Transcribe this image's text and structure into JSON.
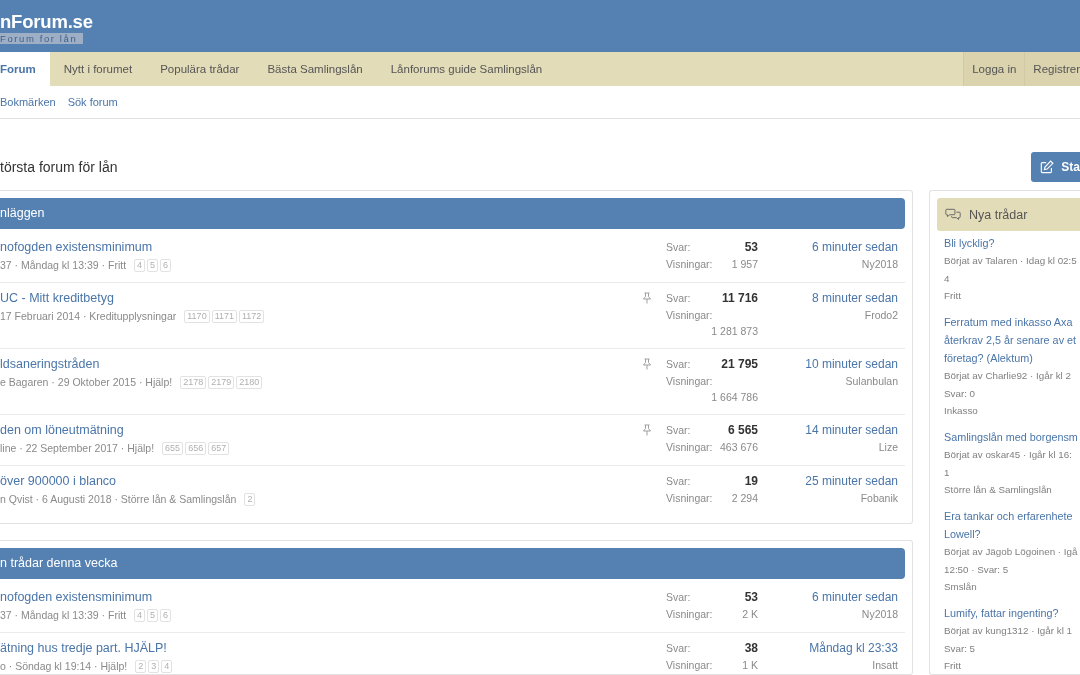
{
  "header": {
    "logo": "nForum.se",
    "tagline": "Forum for lån"
  },
  "nav": {
    "tabs": [
      {
        "label": "Forum",
        "selected": true
      },
      {
        "label": "Nytt i forumet",
        "selected": false
      },
      {
        "label": "Populära trådar",
        "selected": false
      },
      {
        "label": "Bästa Samlingslån",
        "selected": false
      },
      {
        "label": "Lånforums guide Samlingslån",
        "selected": false
      }
    ],
    "account_links": [
      "Logga in",
      "Registrer"
    ]
  },
  "sub_nav": [
    "Bokmärken",
    "Sök forum"
  ],
  "page": {
    "title": "törsta forum för lån",
    "new_thread_button": "Sta"
  },
  "blocks": [
    {
      "title": "nläggen",
      "threads": [
        {
          "title": "nofogden existensminimum",
          "meta": "37 · Måndag kl 13:39 · Fritt",
          "pages": [
            "4",
            "5",
            "6"
          ],
          "pinned": false,
          "replies_label": "Svar:",
          "replies": "53",
          "views_label": "Visningar:",
          "views": "1 957",
          "last_post": "6 minuter sedan",
          "last_poster": "Ny2018"
        },
        {
          "title": "UC - Mitt kreditbetyg",
          "meta": "17 Februari 2014 · Kreditupplysningar",
          "pages": [
            "1170",
            "1171",
            "1172"
          ],
          "pinned": true,
          "replies_label": "Svar:",
          "replies": "11 716",
          "views_label": "Visningar:",
          "views": "1 281 873",
          "last_post": "8 minuter sedan",
          "last_poster": "Frodo2"
        },
        {
          "title": "ldsaneringstråden",
          "meta": "e Bagaren · 29 Oktober 2015 · Hjälp!",
          "pages": [
            "2178",
            "2179",
            "2180"
          ],
          "pinned": true,
          "replies_label": "Svar:",
          "replies": "21 795",
          "views_label": "Visningar:",
          "views": "1 664 786",
          "last_post": "10 minuter sedan",
          "last_poster": "Sulanbulan"
        },
        {
          "title": "den om löneutmätning",
          "meta": "line · 22 September 2017 · Hjälp!",
          "pages": [
            "655",
            "656",
            "657"
          ],
          "pinned": true,
          "replies_label": "Svar:",
          "replies": "6 565",
          "views_label": "Visningar:",
          "views": "463 676",
          "last_post": "14 minuter sedan",
          "last_poster": "Lize"
        },
        {
          "title": "över 900000 i blanco",
          "meta": "n Qvist · 6 Augusti 2018 · Större lån & Samlingslån",
          "pages": [
            "2"
          ],
          "pinned": false,
          "replies_label": "Svar:",
          "replies": "19",
          "views_label": "Visningar:",
          "views": "2 294",
          "last_post": "25 minuter sedan",
          "last_poster": "Fobanik"
        }
      ]
    },
    {
      "title": "n trådar denna vecka",
      "threads": [
        {
          "title": "nofogden existensminimum",
          "meta": "37 · Måndag kl 13:39 · Fritt",
          "pages": [
            "4",
            "5",
            "6"
          ],
          "pinned": false,
          "replies_label": "Svar:",
          "replies": "53",
          "views_label": "Visningar:",
          "views": "2 K",
          "last_post": "6 minuter sedan",
          "last_poster": "Ny2018"
        },
        {
          "title": "ätning hus tredje part. HJÄLP!",
          "meta": "o · Söndag kl 19:14 · Hjälp!",
          "pages": [
            "2",
            "3",
            "4"
          ],
          "pinned": false,
          "replies_label": "Svar:",
          "replies": "38",
          "views_label": "Visningar:",
          "views": "1 K",
          "last_post": "Måndag kl 23:33",
          "last_poster": "Insatt"
        }
      ]
    }
  ],
  "sidebar": {
    "title": "Nya trådar",
    "threads": [
      {
        "title_lines": [
          "Bli lycklig?"
        ],
        "meta_lines": [
          "Börjat av Talaren · Idag kl 02:5",
          "4"
        ],
        "forum": "Fritt"
      },
      {
        "title_lines": [
          "Ferratum med inkasso Axa",
          "återkrav 2,5 år senare av et",
          "företag? (Alektum)"
        ],
        "meta_lines": [
          "Börjat av Charlie92 · Igår kl 2",
          "Svar: 0"
        ],
        "forum": "Inkasso"
      },
      {
        "title_lines": [
          "Samlingslån med borgensm"
        ],
        "meta_lines": [
          "Börjat av oskar45 · Igår kl 16:",
          "1"
        ],
        "forum": "Större lån & Samlingslån"
      },
      {
        "title_lines": [
          "Era tankar och erfarenhete",
          "Lowell?"
        ],
        "meta_lines": [
          "Börjat av Jägob Lögoinen · Igå",
          "12:50 · Svar: 5"
        ],
        "forum": "Smslån"
      },
      {
        "title_lines": [
          "Lumify, fattar ingenting?"
        ],
        "meta_lines": [
          "Börjat av kung1312 · Igår kl 1",
          "Svar: 5"
        ],
        "forum": "Fritt"
      }
    ]
  }
}
